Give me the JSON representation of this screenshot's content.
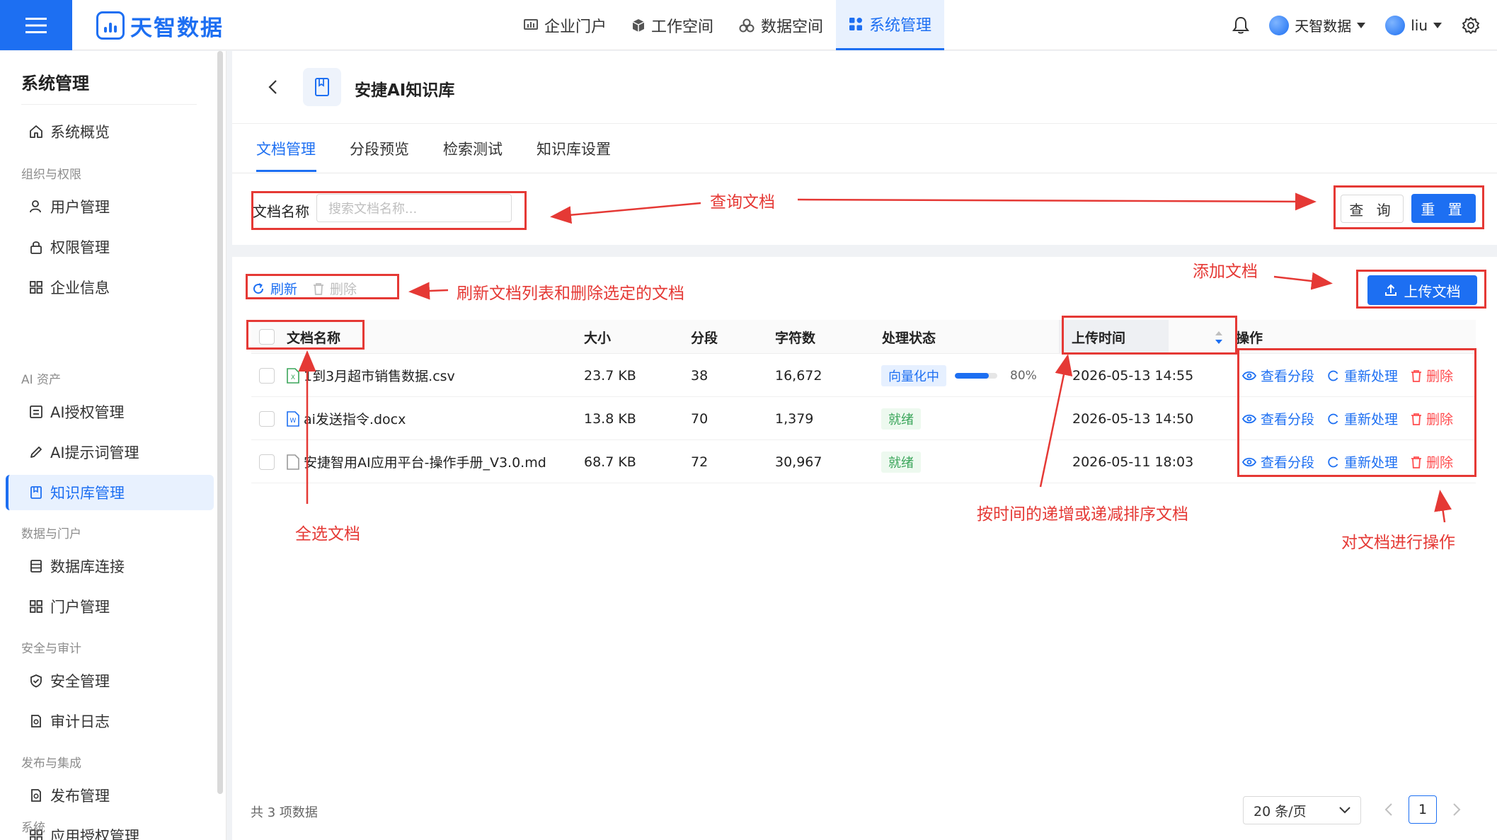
{
  "topbar": {
    "brand": "天智数据",
    "nav": [
      {
        "label": "企业门户",
        "icon": "chart-bar-icon"
      },
      {
        "label": "工作空间",
        "icon": "cube-icon"
      },
      {
        "label": "数据空间",
        "icon": "cubes-icon"
      },
      {
        "label": "系统管理",
        "icon": "grid-icon",
        "active": true
      }
    ],
    "tenant": "天智数据",
    "user": "liu"
  },
  "sidebar": {
    "title": "系统管理",
    "overview": "系统概览",
    "groups": [
      {
        "label": "组织与权限",
        "items": [
          "用户管理",
          "权限管理",
          "企业信息"
        ]
      },
      {
        "label": "AI 资产",
        "items": [
          "AI授权管理",
          "AI提示词管理",
          "知识库管理"
        ]
      },
      {
        "label": "数据与门户",
        "items": [
          "数据库连接",
          "门户管理"
        ]
      },
      {
        "label": "安全与审计",
        "items": [
          "安全管理",
          "审计日志"
        ]
      },
      {
        "label": "发布与集成",
        "items": [
          "发布管理",
          "应用授权管理"
        ]
      },
      {
        "label": "系统",
        "items": []
      }
    ],
    "active": "知识库管理"
  },
  "header": {
    "title": "安捷AI知识库",
    "tabs": [
      "文档管理",
      "分段预览",
      "检索测试",
      "知识库设置"
    ],
    "active_tab": "文档管理"
  },
  "search": {
    "label": "文档名称",
    "placeholder": "搜索文档名称...",
    "query_label": "查 询",
    "reset_label": "重 置"
  },
  "toolbar": {
    "refresh_label": "刷新",
    "delete_label": "删除",
    "upload_label": "上传文档"
  },
  "table": {
    "columns": {
      "name": "文档名称",
      "size": "大小",
      "segments": "分段",
      "chars": "字符数",
      "status": "处理状态",
      "uploaded": "上传时间",
      "actions": "操作"
    },
    "rows": [
      {
        "name": "1到3月超市销售数据.csv",
        "file_type": "csv",
        "size": "23.7 KB",
        "segments": "38",
        "chars": "16,672",
        "status": "向量化中",
        "status_kind": "processing",
        "progress": 0.8,
        "progress_label": "80%",
        "uploaded": "2026-05-13 14:55"
      },
      {
        "name": "ai发送指令.docx",
        "file_type": "docx",
        "size": "13.8 KB",
        "segments": "70",
        "chars": "1,379",
        "status": "就绪",
        "status_kind": "ready",
        "progress": null,
        "progress_label": "",
        "uploaded": "2026-05-13 14:50"
      },
      {
        "name": "安捷智用AI应用平台-操作手册_V3.0.md",
        "file_type": "md",
        "size": "68.7 KB",
        "segments": "72",
        "chars": "30,967",
        "status": "就绪",
        "status_kind": "ready",
        "progress": null,
        "progress_label": "",
        "uploaded": "2026-05-11 18:03"
      }
    ],
    "actions": {
      "view": "查看分段",
      "reprocess": "重新处理",
      "delete": "删除"
    }
  },
  "footer": {
    "total": "共 3 项数据",
    "page_size": "20 条/页",
    "page": "1"
  },
  "annotations": {
    "query": "查询文档",
    "toolbar": "刷新文档列表和删除选定的文档",
    "upload": "添加文档",
    "select_all": "全选文档",
    "sort": "按时间的递增或递减排序文档",
    "actions": "对文档进行操作"
  },
  "colors": {
    "primary": "#1d6ff2",
    "annotation": "#e53935",
    "ready": "#3aa55a",
    "danger": "#ff4d4f"
  }
}
